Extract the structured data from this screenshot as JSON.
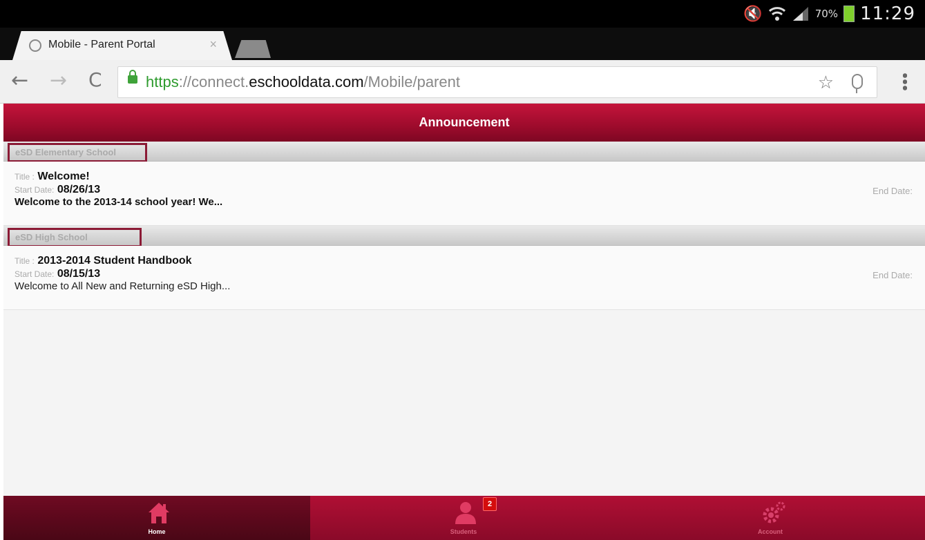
{
  "status_bar": {
    "battery": "70%",
    "time": "11:29"
  },
  "browser": {
    "tab_title": "Mobile - Parent Portal",
    "tab_close": "×",
    "url": {
      "scheme": "https",
      "separator": "://connect.",
      "domain": "eschooldata.com",
      "path": "/Mobile/parent"
    }
  },
  "app": {
    "header_title": "Announcement"
  },
  "sections": [
    {
      "school": "eSD Elementary School",
      "announcements": [
        {
          "title_label": "Title :",
          "title": "Welcome!",
          "start_label": "Start Date:",
          "start_date": "08/26/13",
          "body": "Welcome to the 2013-14 school year!  We...",
          "end_label": "End Date:"
        }
      ]
    },
    {
      "school": "eSD High School",
      "announcements": [
        {
          "title_label": "Title :",
          "title": "2013-2014 Student Handbook",
          "start_label": "Start Date:",
          "start_date": "08/15/13",
          "body": "Welcome to All New and Returning eSD High...",
          "end_label": "End Date:"
        }
      ]
    }
  ],
  "bottom_nav": {
    "home_label": "Home",
    "students_label": "Students",
    "students_badge": "2",
    "account_label": "Account"
  },
  "colors": {
    "brand_red": "#9d0b2c",
    "section_outline": "#8b1a35",
    "badge_red": "#d40d0d"
  },
  "icons": [
    "mute-icon",
    "wifi-icon",
    "signal-icon",
    "battery-icon",
    "back-arrow-icon",
    "forward-arrow-icon",
    "reload-icon",
    "lock-icon",
    "star-icon",
    "mic-icon",
    "menu-icon",
    "home-icon",
    "person-icon",
    "gear-icon"
  ]
}
